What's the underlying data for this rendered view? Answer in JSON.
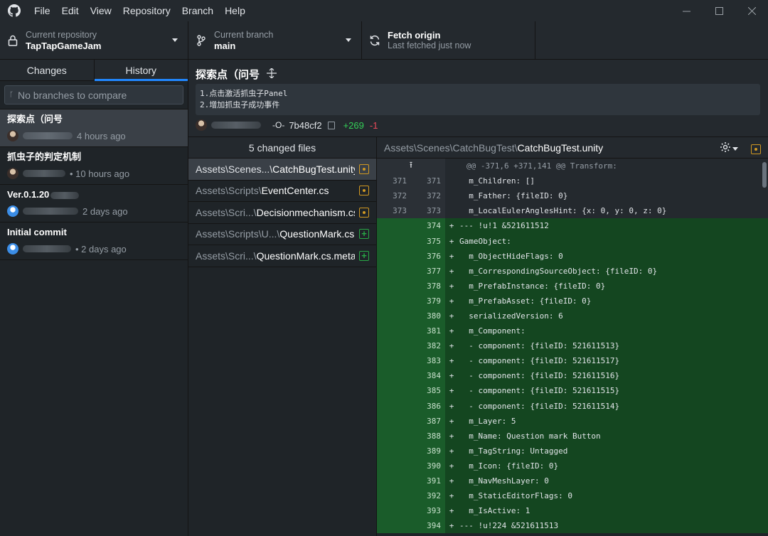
{
  "menu": {
    "items": [
      "File",
      "Edit",
      "View",
      "Repository",
      "Branch",
      "Help"
    ]
  },
  "toolbar": {
    "repo_label": "Current repository",
    "repo_value": "TapTapGameJam",
    "branch_label": "Current branch",
    "branch_value": "main",
    "fetch_label": "Fetch origin",
    "fetch_sub": "Last fetched just now"
  },
  "sidebar": {
    "tabs": [
      "Changes",
      "History"
    ],
    "active_tab": "History",
    "compare_placeholder": "No branches to compare",
    "commits": [
      {
        "title": "探索点（问号",
        "time": "4 hours ago",
        "selected": true,
        "avatar": "a1"
      },
      {
        "title": "抓虫子的判定机制",
        "time": "• 10 hours ago",
        "selected": false,
        "avatar": "a1"
      },
      {
        "title": "Ver.0.1.20",
        "time": "2 days ago",
        "selected": false,
        "avatar": "a2"
      },
      {
        "title": "Initial commit",
        "time": "• 2 days ago",
        "selected": false,
        "avatar": "a2"
      }
    ]
  },
  "commit": {
    "title": "探索点（问号",
    "description_lines": [
      "1.点击激活抓虫子Panel",
      "2.增加抓虫子成功事件"
    ],
    "sha": "7b48cf2",
    "additions": "+269",
    "deletions": "-1"
  },
  "files": {
    "header": "5 changed files",
    "items": [
      {
        "dir": "Assets\\Scenes...\\",
        "name": "CatchBugTest.unity",
        "status": "modified",
        "selected": true
      },
      {
        "dir": "Assets\\Scripts\\",
        "name": "EventCenter.cs",
        "status": "modified",
        "selected": false
      },
      {
        "dir": "Assets\\Scri...\\",
        "name": "Decisionmechanism.cs",
        "status": "modified",
        "selected": false
      },
      {
        "dir": "Assets\\Scripts\\U...\\",
        "name": "QuestionMark.cs",
        "status": "added",
        "selected": false
      },
      {
        "dir": "Assets\\Scri...\\",
        "name": "QuestionMark.cs.meta",
        "status": "added",
        "selected": false
      }
    ]
  },
  "diff": {
    "path_dir": "Assets\\Scenes\\CatchBugTest\\",
    "path_file": "CatchBugTest.unity",
    "hunk": "@@ -371,6 +371,141 @@ Transform:",
    "lines": [
      {
        "type": "ctx",
        "old": "371",
        "new": "371",
        "text": "  m_Children: []"
      },
      {
        "type": "ctx",
        "old": "372",
        "new": "372",
        "text": "  m_Father: {fileID: 0}"
      },
      {
        "type": "ctx",
        "old": "373",
        "new": "373",
        "text": "  m_LocalEulerAnglesHint: {x: 0, y: 0, z: 0}"
      },
      {
        "type": "add",
        "old": "",
        "new": "374",
        "text": "--- !u!1 &521611512"
      },
      {
        "type": "add",
        "old": "",
        "new": "375",
        "text": "GameObject:"
      },
      {
        "type": "add",
        "old": "",
        "new": "376",
        "text": "  m_ObjectHideFlags: 0"
      },
      {
        "type": "add",
        "old": "",
        "new": "377",
        "text": "  m_CorrespondingSourceObject: {fileID: 0}"
      },
      {
        "type": "add",
        "old": "",
        "new": "378",
        "text": "  m_PrefabInstance: {fileID: 0}"
      },
      {
        "type": "add",
        "old": "",
        "new": "379",
        "text": "  m_PrefabAsset: {fileID: 0}"
      },
      {
        "type": "add",
        "old": "",
        "new": "380",
        "text": "  serializedVersion: 6"
      },
      {
        "type": "add",
        "old": "",
        "new": "381",
        "text": "  m_Component:"
      },
      {
        "type": "add",
        "old": "",
        "new": "382",
        "text": "  - component: {fileID: 521611513}"
      },
      {
        "type": "add",
        "old": "",
        "new": "383",
        "text": "  - component: {fileID: 521611517}"
      },
      {
        "type": "add",
        "old": "",
        "new": "384",
        "text": "  - component: {fileID: 521611516}"
      },
      {
        "type": "add",
        "old": "",
        "new": "385",
        "text": "  - component: {fileID: 521611515}"
      },
      {
        "type": "add",
        "old": "",
        "new": "386",
        "text": "  - component: {fileID: 521611514}"
      },
      {
        "type": "add",
        "old": "",
        "new": "387",
        "text": "  m_Layer: 5"
      },
      {
        "type": "add",
        "old": "",
        "new": "388",
        "text": "  m_Name: Question mark Button"
      },
      {
        "type": "add",
        "old": "",
        "new": "389",
        "text": "  m_TagString: Untagged"
      },
      {
        "type": "add",
        "old": "",
        "new": "390",
        "text": "  m_Icon: {fileID: 0}"
      },
      {
        "type": "add",
        "old": "",
        "new": "391",
        "text": "  m_NavMeshLayer: 0"
      },
      {
        "type": "add",
        "old": "",
        "new": "392",
        "text": "  m_StaticEditorFlags: 0"
      },
      {
        "type": "add",
        "old": "",
        "new": "393",
        "text": "  m_IsActive: 1"
      },
      {
        "type": "add",
        "old": "",
        "new": "394",
        "text": "--- !u!224 &521611513"
      }
    ]
  },
  "colors": {
    "bg": "#24292e",
    "accent": "#2188ff",
    "added_bg": "#144620",
    "modified": "#d29922",
    "added": "#28a745"
  }
}
